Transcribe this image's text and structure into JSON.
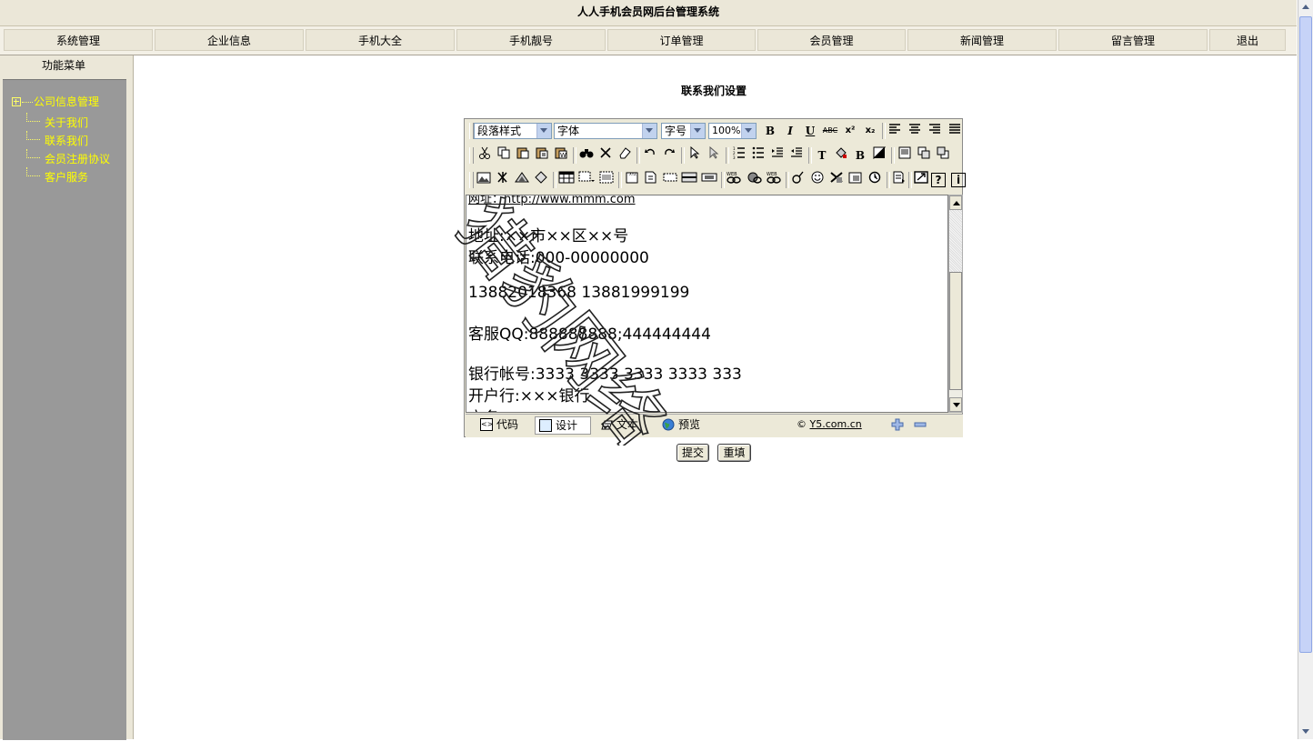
{
  "app_title": "人人手机会员网后台管理系统",
  "nav": [
    {
      "label": "系统管理"
    },
    {
      "label": "企业信息"
    },
    {
      "label": "手机大全"
    },
    {
      "label": "手机靓号"
    },
    {
      "label": "订单管理"
    },
    {
      "label": "会员管理"
    },
    {
      "label": "新闻管理"
    },
    {
      "label": "留言管理"
    },
    {
      "label": "退出"
    }
  ],
  "sidebar": {
    "header": "功能菜单",
    "root": "公司信息管理",
    "items": [
      {
        "label": "关于我们"
      },
      {
        "label": "联系我们"
      },
      {
        "label": "会员注册协议"
      },
      {
        "label": "客户服务"
      }
    ]
  },
  "main": {
    "title": "联系我们设置"
  },
  "editor": {
    "paragraph_style": "段落样式",
    "font": "字体",
    "font_size": "字号",
    "zoom": "100%",
    "content_lines": [
      "网址：http://www.mmm.com",
      "地址:××市××区××号",
      "联系电话:000-00000000",
      "13882018368  13881999199",
      "客服QQ:888888888;444444444",
      "银行帐号:3333 3333 3333 3333 333",
      "开户行:×××银行",
      "户名:×××"
    ],
    "modes": [
      {
        "label": "代码"
      },
      {
        "label": "设计"
      },
      {
        "label": "文本"
      },
      {
        "label": "预览"
      }
    ],
    "active_mode": "设计",
    "copyright_symbol": "©",
    "copyright_link": "Y5.com.cn"
  },
  "buttons": {
    "submit": "提交",
    "reset": "重填"
  },
  "watermark_text": "猎豹网络",
  "colors": {
    "sidebar_link": "#ffff00",
    "sidebar_bg": "#999999",
    "frame_bg": "#ebe7d8"
  }
}
